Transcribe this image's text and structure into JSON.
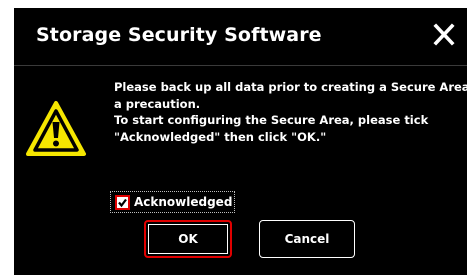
{
  "dialog": {
    "title": "Storage Security Software",
    "close_icon": "close-x-icon",
    "warning_icon": "warning-triangle-icon",
    "message_lines": [
      "Please back up all data prior to creating a Secure Area as",
      "a precaution.",
      "To start configuring the Secure Area, please tick",
      "\"Acknowledged\" then click \"OK.\""
    ],
    "acknowledged": {
      "label": "Acknowledged",
      "checked": true
    },
    "buttons": {
      "ok_label": "OK",
      "cancel_label": "Cancel"
    }
  },
  "colors": {
    "dialog_background": "#000000",
    "text": "#ffffff",
    "highlight": "#e00000",
    "warning_fill": "#f5e600"
  }
}
